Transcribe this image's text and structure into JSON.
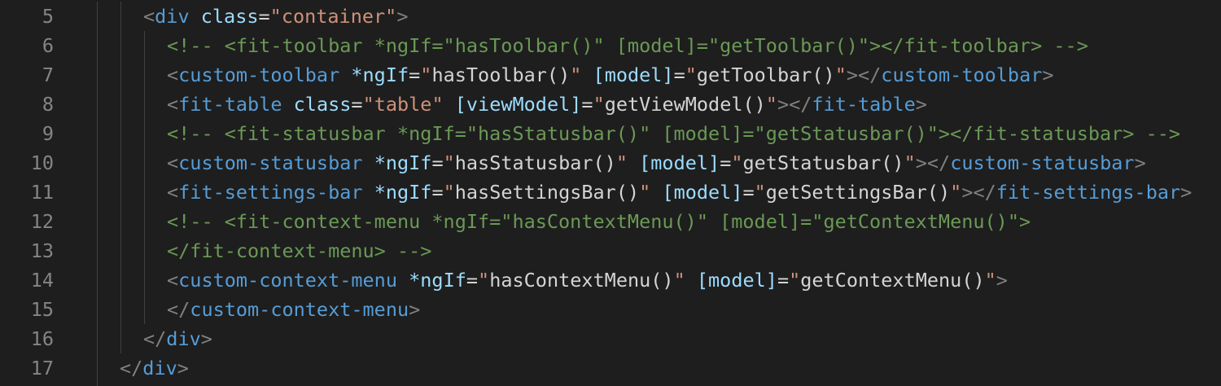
{
  "editor": {
    "lines": [
      {
        "number": "5",
        "indent": 1,
        "tokens": [
          {
            "t": "<",
            "c": "punc"
          },
          {
            "t": "div",
            "c": "tag"
          },
          {
            "t": " ",
            "c": "text"
          },
          {
            "t": "class",
            "c": "attr"
          },
          {
            "t": "=",
            "c": "text"
          },
          {
            "t": "\"container\"",
            "c": "str"
          },
          {
            "t": ">",
            "c": "punc"
          }
        ]
      },
      {
        "number": "6",
        "indent": 2,
        "tokens": [
          {
            "t": "<!-- <fit-toolbar *ngIf=\"hasToolbar()\" [model]=\"getToolbar()\"></fit-toolbar> -->",
            "c": "cmt"
          }
        ]
      },
      {
        "number": "7",
        "indent": 2,
        "tokens": [
          {
            "t": "<",
            "c": "punc"
          },
          {
            "t": "custom-toolbar",
            "c": "tag"
          },
          {
            "t": " ",
            "c": "text"
          },
          {
            "t": "*ngIf",
            "c": "attr"
          },
          {
            "t": "=",
            "c": "text"
          },
          {
            "t": "\"",
            "c": "str"
          },
          {
            "t": "hasToolbar()",
            "c": "text"
          },
          {
            "t": "\"",
            "c": "str"
          },
          {
            "t": " ",
            "c": "text"
          },
          {
            "t": "[model]",
            "c": "attr"
          },
          {
            "t": "=",
            "c": "text"
          },
          {
            "t": "\"",
            "c": "str"
          },
          {
            "t": "getToolbar()",
            "c": "text"
          },
          {
            "t": "\"",
            "c": "str"
          },
          {
            "t": "></",
            "c": "punc"
          },
          {
            "t": "custom-toolbar",
            "c": "tag"
          },
          {
            "t": ">",
            "c": "punc"
          }
        ]
      },
      {
        "number": "8",
        "indent": 2,
        "tokens": [
          {
            "t": "<",
            "c": "punc"
          },
          {
            "t": "fit-table",
            "c": "tag"
          },
          {
            "t": " ",
            "c": "text"
          },
          {
            "t": "class",
            "c": "attr"
          },
          {
            "t": "=",
            "c": "text"
          },
          {
            "t": "\"table\"",
            "c": "str"
          },
          {
            "t": " ",
            "c": "text"
          },
          {
            "t": "[viewModel]",
            "c": "attr"
          },
          {
            "t": "=",
            "c": "text"
          },
          {
            "t": "\"",
            "c": "str"
          },
          {
            "t": "getViewModel()",
            "c": "text"
          },
          {
            "t": "\"",
            "c": "str"
          },
          {
            "t": "></",
            "c": "punc"
          },
          {
            "t": "fit-table",
            "c": "tag"
          },
          {
            "t": ">",
            "c": "punc"
          }
        ]
      },
      {
        "number": "9",
        "indent": 2,
        "tokens": [
          {
            "t": "<!-- <fit-statusbar *ngIf=\"hasStatusbar()\" [model]=\"getStatusbar()\"></fit-statusbar> -->",
            "c": "cmt"
          }
        ]
      },
      {
        "number": "10",
        "indent": 2,
        "tokens": [
          {
            "t": "<",
            "c": "punc"
          },
          {
            "t": "custom-statusbar",
            "c": "tag"
          },
          {
            "t": " ",
            "c": "text"
          },
          {
            "t": "*ngIf",
            "c": "attr"
          },
          {
            "t": "=",
            "c": "text"
          },
          {
            "t": "\"",
            "c": "str"
          },
          {
            "t": "hasStatusbar()",
            "c": "text"
          },
          {
            "t": "\"",
            "c": "str"
          },
          {
            "t": " ",
            "c": "text"
          },
          {
            "t": "[model]",
            "c": "attr"
          },
          {
            "t": "=",
            "c": "text"
          },
          {
            "t": "\"",
            "c": "str"
          },
          {
            "t": "getStatusbar()",
            "c": "text"
          },
          {
            "t": "\"",
            "c": "str"
          },
          {
            "t": "></",
            "c": "punc"
          },
          {
            "t": "custom-statusbar",
            "c": "tag"
          },
          {
            "t": ">",
            "c": "punc"
          }
        ]
      },
      {
        "number": "11",
        "indent": 2,
        "tokens": [
          {
            "t": "<",
            "c": "punc"
          },
          {
            "t": "fit-settings-bar",
            "c": "tag"
          },
          {
            "t": " ",
            "c": "text"
          },
          {
            "t": "*ngIf",
            "c": "attr"
          },
          {
            "t": "=",
            "c": "text"
          },
          {
            "t": "\"",
            "c": "str"
          },
          {
            "t": "hasSettingsBar()",
            "c": "text"
          },
          {
            "t": "\"",
            "c": "str"
          },
          {
            "t": " ",
            "c": "text"
          },
          {
            "t": "[model]",
            "c": "attr"
          },
          {
            "t": "=",
            "c": "text"
          },
          {
            "t": "\"",
            "c": "str"
          },
          {
            "t": "getSettingsBar()",
            "c": "text"
          },
          {
            "t": "\"",
            "c": "str"
          },
          {
            "t": "></",
            "c": "punc"
          },
          {
            "t": "fit-settings-bar",
            "c": "tag"
          },
          {
            "t": ">",
            "c": "punc"
          }
        ]
      },
      {
        "number": "12",
        "indent": 2,
        "tokens": [
          {
            "t": "<!-- <fit-context-menu *ngIf=\"hasContextMenu()\" [model]=\"getContextMenu()\">",
            "c": "cmt"
          }
        ]
      },
      {
        "number": "13",
        "indent": 2,
        "tokens": [
          {
            "t": "</fit-context-menu> -->",
            "c": "cmt"
          }
        ]
      },
      {
        "number": "14",
        "indent": 2,
        "tokens": [
          {
            "t": "<",
            "c": "punc"
          },
          {
            "t": "custom-context-menu",
            "c": "tag"
          },
          {
            "t": " ",
            "c": "text"
          },
          {
            "t": "*ngIf",
            "c": "attr"
          },
          {
            "t": "=",
            "c": "text"
          },
          {
            "t": "\"",
            "c": "str"
          },
          {
            "t": "hasContextMenu()",
            "c": "text"
          },
          {
            "t": "\"",
            "c": "str"
          },
          {
            "t": " ",
            "c": "text"
          },
          {
            "t": "[model]",
            "c": "attr"
          },
          {
            "t": "=",
            "c": "text"
          },
          {
            "t": "\"",
            "c": "str"
          },
          {
            "t": "getContextMenu()",
            "c": "text"
          },
          {
            "t": "\"",
            "c": "str"
          },
          {
            "t": ">",
            "c": "punc"
          }
        ]
      },
      {
        "number": "15",
        "indent": 2,
        "tokens": [
          {
            "t": "</",
            "c": "punc"
          },
          {
            "t": "custom-context-menu",
            "c": "tag"
          },
          {
            "t": ">",
            "c": "punc"
          }
        ]
      },
      {
        "number": "16",
        "indent": 1,
        "tokens": [
          {
            "t": "</",
            "c": "punc"
          },
          {
            "t": "div",
            "c": "tag"
          },
          {
            "t": ">",
            "c": "punc"
          }
        ]
      },
      {
        "number": "17",
        "indent": 0,
        "tokens": [
          {
            "t": "</",
            "c": "punc"
          },
          {
            "t": "div",
            "c": "tag"
          },
          {
            "t": ">",
            "c": "punc"
          }
        ]
      }
    ]
  },
  "colors": {
    "background": "#1e1e1e",
    "line_number": "#858585",
    "punctuation": "#808080",
    "tag": "#569cd6",
    "attribute": "#9cdcfe",
    "string": "#ce9178",
    "text": "#d4d4d4",
    "comment": "#6a9955",
    "indent_guide": "#404040"
  }
}
